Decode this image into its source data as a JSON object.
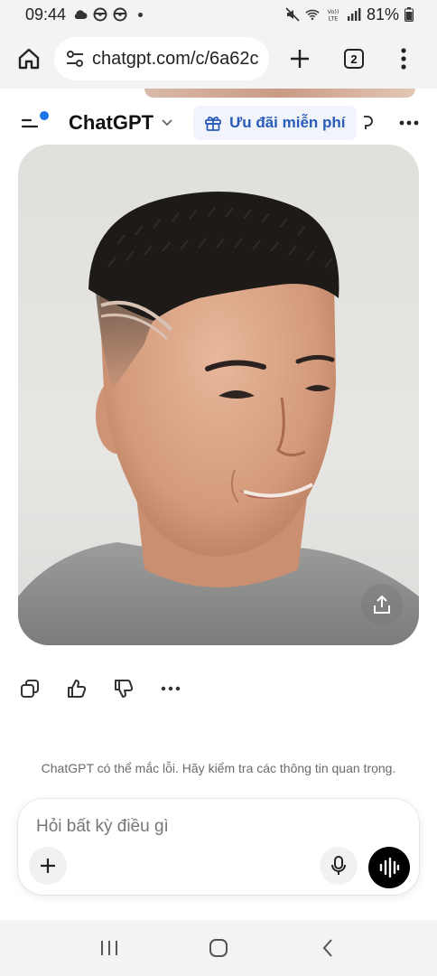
{
  "status_bar": {
    "time": "09:44",
    "battery": "81%",
    "left_icons": [
      "cloud-icon",
      "steering-wheel-icon",
      "steering-wheel-icon",
      "dot-icon"
    ],
    "right_icons": [
      "mute-icon",
      "wifi-icon",
      "volte-icon",
      "signal-icon",
      "battery-icon"
    ]
  },
  "browser": {
    "url": "chatgpt.com/c/6a62c",
    "tab_count": "2"
  },
  "chat_header": {
    "title": "ChatGPT",
    "promo_label": "Ưu đãi miễn phí"
  },
  "image_card": {
    "alt_description_icon": "generated-image"
  },
  "actions": [
    "copy-icon",
    "thumbs-up-icon",
    "thumbs-down-icon",
    "more-horizontal-icon"
  ],
  "disclaimer": "ChatGPT có thể mắc lỗi. Hãy kiểm tra các thông tin quan trọng.",
  "composer": {
    "placeholder": "Hỏi bất kỳ điều gì"
  },
  "colors": {
    "accent_blue": "#1a73e8",
    "promo_blue": "#2a5bb8",
    "voice_button": "#000000",
    "chrome_bg": "#f3f3f3"
  }
}
